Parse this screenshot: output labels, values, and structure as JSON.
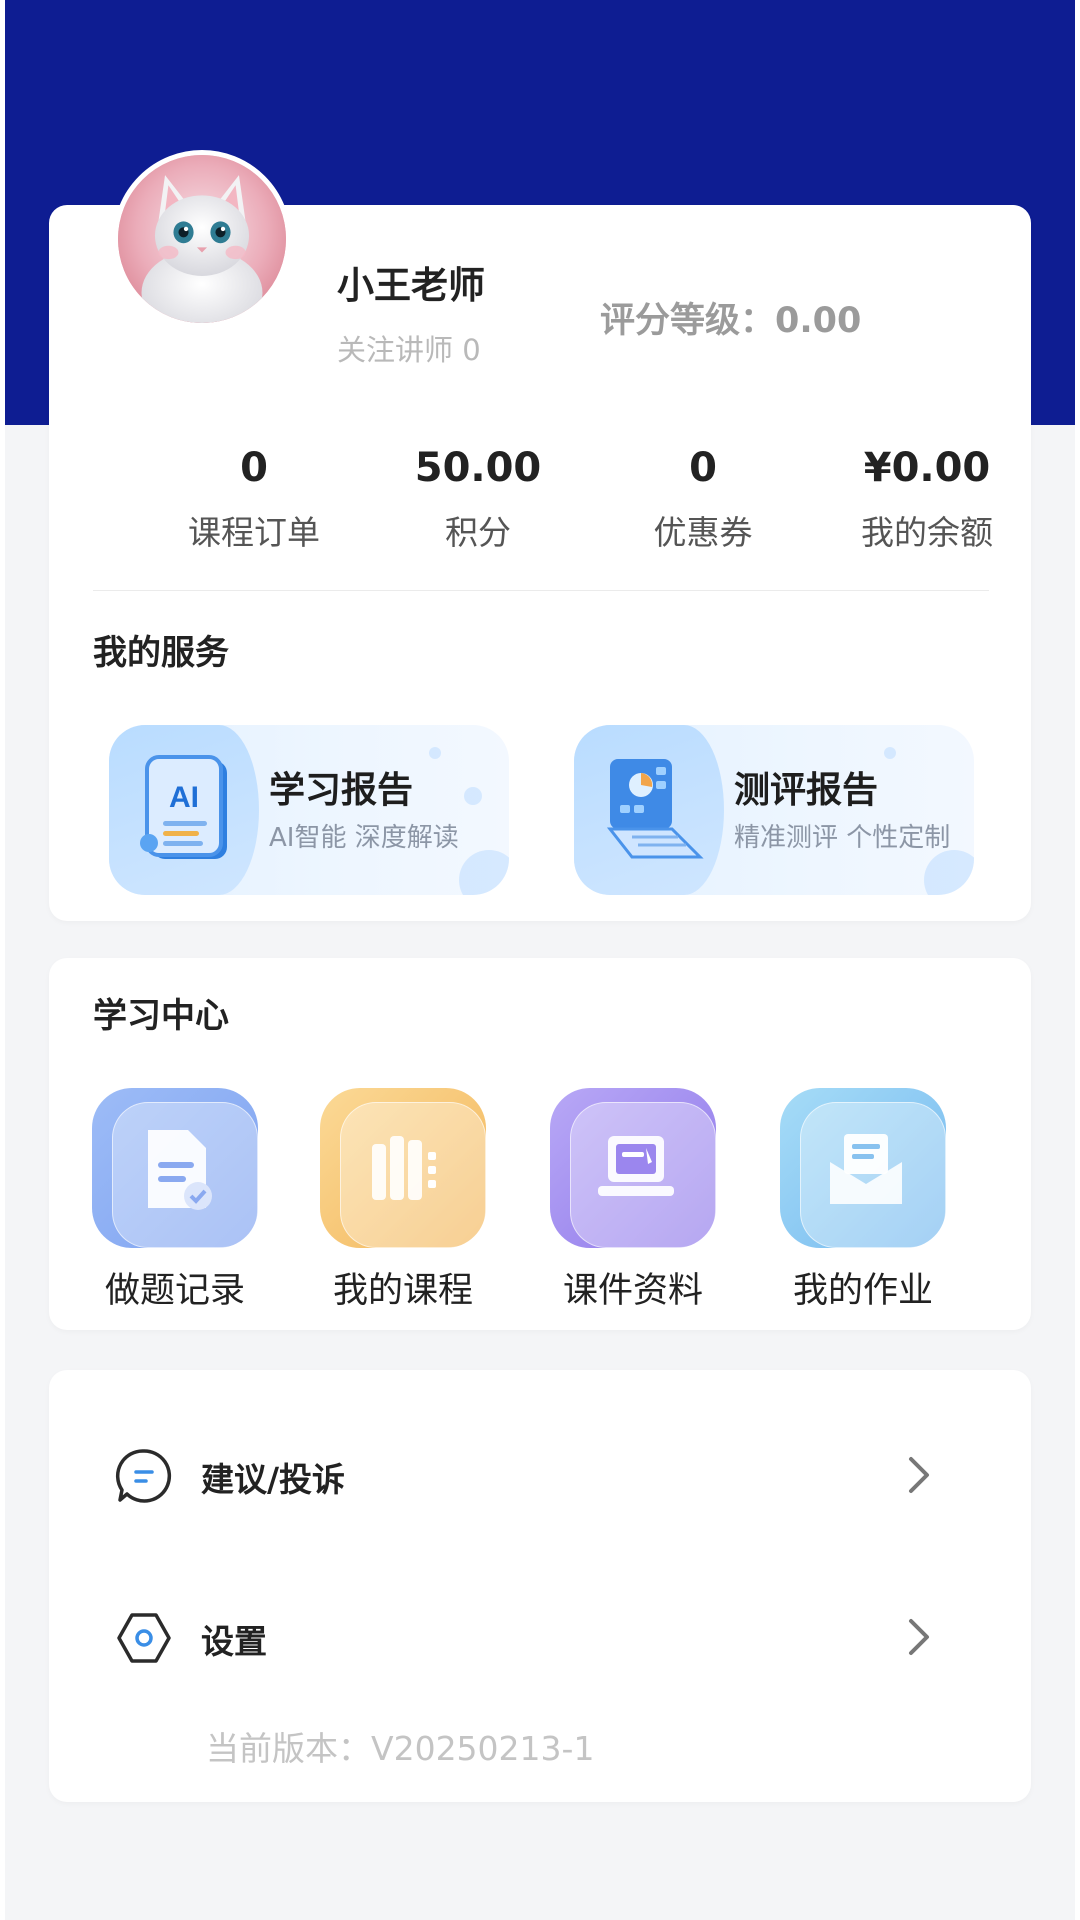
{
  "profile": {
    "name": "小王老师",
    "follow_text": "关注讲师 0",
    "rating_text": "评分等级：0.00"
  },
  "stats": [
    {
      "value": "0",
      "label": "课程订单"
    },
    {
      "value": "50.00",
      "label": "积分"
    },
    {
      "value": "0",
      "label": "优惠券"
    },
    {
      "value": "¥0.00",
      "label": "我的余额"
    }
  ],
  "services": {
    "title": "我的服务",
    "items": [
      {
        "title": "学习报告",
        "subtitle": "AI智能 深度解读",
        "icon": "ai-report-icon"
      },
      {
        "title": "测评报告",
        "subtitle": "精准测评 个性定制",
        "icon": "assessment-laptop-icon"
      }
    ]
  },
  "study_center": {
    "title": "学习中心",
    "items": [
      {
        "label": "做题记录",
        "icon": "exercise-record-icon",
        "color": "#8fb0f5"
      },
      {
        "label": "我的课程",
        "icon": "my-courses-icon",
        "color": "#f5c46c"
      },
      {
        "label": "课件资料",
        "icon": "courseware-icon",
        "color": "#a896f2"
      },
      {
        "label": "我的作业",
        "icon": "homework-icon",
        "color": "#8ccaf2"
      }
    ]
  },
  "menu": {
    "items": [
      {
        "label": "建议/投诉",
        "icon": "feedback-icon"
      },
      {
        "label": "设置",
        "icon": "settings-icon"
      }
    ],
    "version_text": "当前版本：V20250213-1"
  },
  "colors": {
    "header": "#0e1d92",
    "accent": "#3a8ee6"
  }
}
